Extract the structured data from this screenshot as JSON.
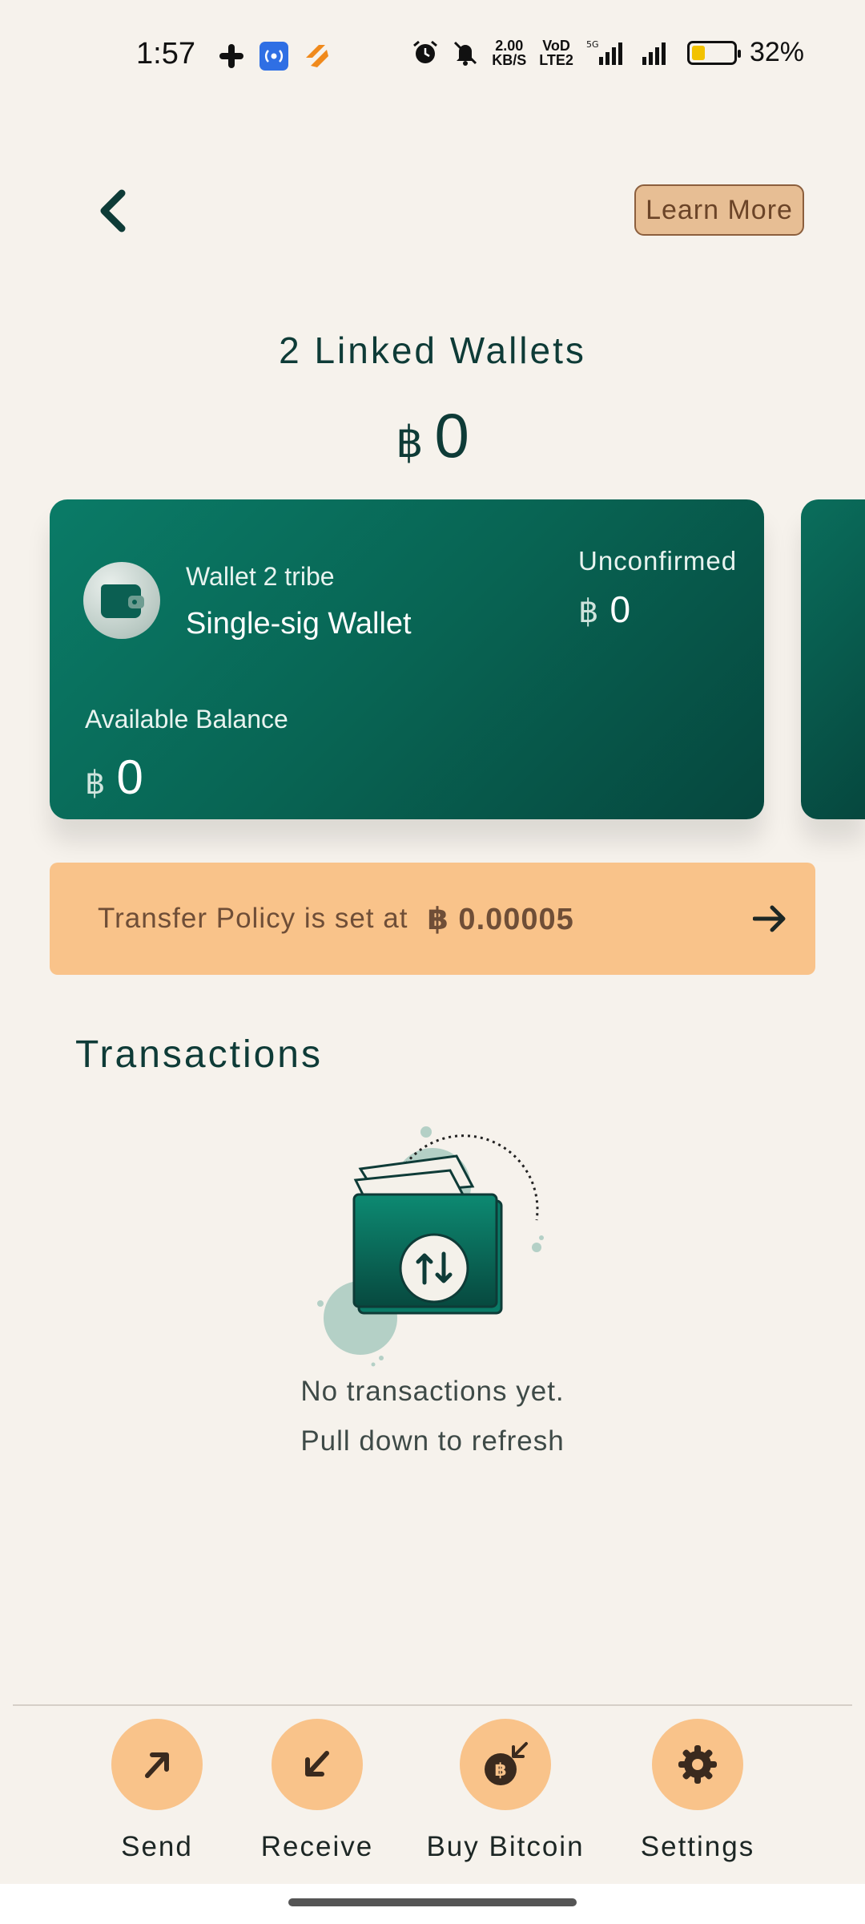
{
  "status_bar": {
    "time": "1:57",
    "network_speed_value": "2.00",
    "network_speed_unit": "KB/S",
    "volte_line1": "VoD",
    "volte_line2": "LTE2",
    "network_type": "5G",
    "battery_percent": "32%",
    "battery_level": 0.32,
    "icons": [
      "slack-icon",
      "hotspot-icon",
      "app-icon",
      "alarm-icon",
      "mute-icon",
      "signal-icon",
      "signal-icon",
      "battery-icon"
    ]
  },
  "header": {
    "back_icon": "chevron-left-icon",
    "learn_more_label": "Learn More"
  },
  "summary": {
    "title": "2 Linked Wallets",
    "currency_symbol": "฿",
    "total_balance": "0"
  },
  "wallet_card": {
    "icon": "wallet-icon",
    "name": "Wallet 2 tribe",
    "type": "Single-sig Wallet",
    "unconfirmed_label": "Unconfirmed",
    "unconfirmed_symbol": "฿",
    "unconfirmed_value": "0",
    "available_label": "Available Balance",
    "available_symbol": "฿",
    "available_value": "0"
  },
  "transfer_policy": {
    "text": "Transfer Policy is set at",
    "value": "฿ 0.00005",
    "icon": "arrow-right-icon"
  },
  "transactions": {
    "title": "Transactions",
    "empty_line1": "No transactions yet.",
    "empty_line2": "Pull down to refresh",
    "illustration_icon": "wallet-transfer-illustration"
  },
  "bottom_nav": [
    {
      "label": "Send",
      "icon": "send-arrow-icon"
    },
    {
      "label": "Receive",
      "icon": "receive-arrow-icon"
    },
    {
      "label": "Buy Bitcoin",
      "icon": "buy-bitcoin-icon"
    },
    {
      "label": "Settings",
      "icon": "gear-icon"
    }
  ],
  "colors": {
    "background": "#F6F2EC",
    "primary_green": "#086453",
    "accent_peach": "#F9C38A",
    "text_dark": "#0E3B37"
  }
}
